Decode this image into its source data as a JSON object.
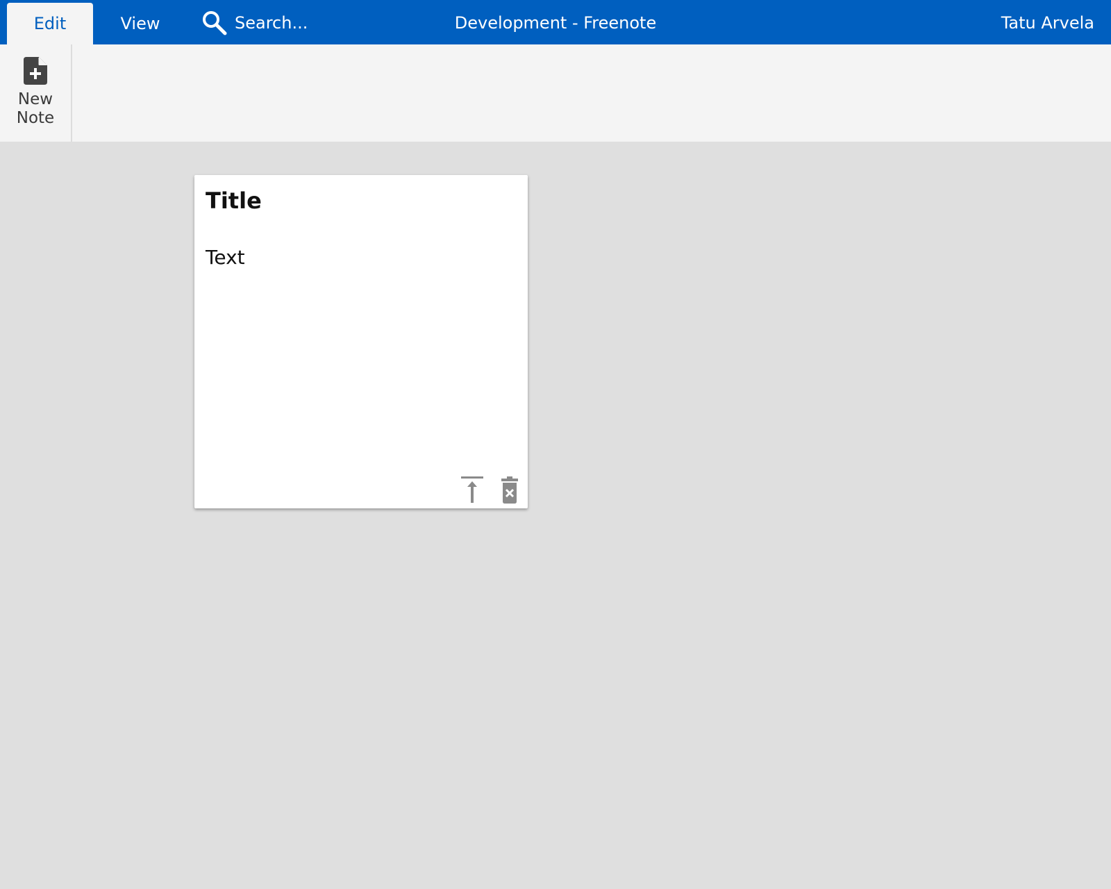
{
  "topbar": {
    "tabs": [
      {
        "label": "Edit",
        "active": true
      },
      {
        "label": "View",
        "active": false
      }
    ],
    "search": {
      "placeholder": "Search...",
      "value": "",
      "icon": "search-icon"
    },
    "app_title": "Development - Freenote",
    "user_name": "Tatu Arvela"
  },
  "ribbon": {
    "new_note": {
      "label": "New Note",
      "icon": "file-plus-icon"
    }
  },
  "notes": [
    {
      "title": "Title",
      "text": "Text",
      "actions": [
        {
          "icon": "move-to-top-icon"
        },
        {
          "icon": "delete-icon"
        }
      ]
    }
  ],
  "colors": {
    "topbar": "#005fbf",
    "ribbon": "#f4f4f4",
    "canvas": "#dfdfdf",
    "note": "#ffffff",
    "note_action_icon": "#8a8a8a",
    "ribbon_icon": "#444444"
  }
}
